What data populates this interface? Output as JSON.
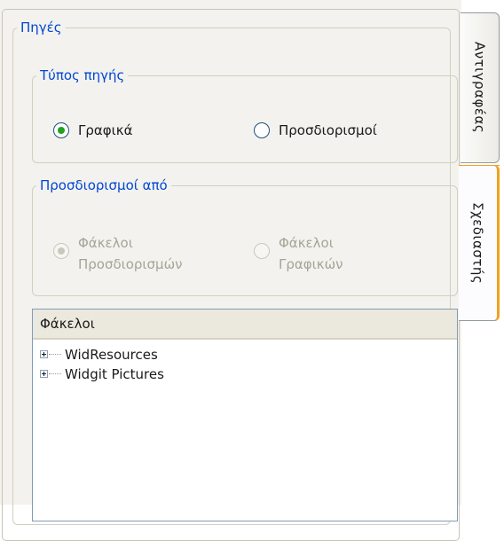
{
  "sources": {
    "title": "Πηγές",
    "source_type": {
      "title": "Τύπος πηγής",
      "options": [
        {
          "label": "Γραφικά",
          "checked": true
        },
        {
          "label": "Προσδιορισμοί",
          "checked": false
        }
      ]
    },
    "determiners_from": {
      "title": "Προσδιορισμοί από",
      "disabled": true,
      "options": [
        {
          "label": "Φάκελοι\nΠροσδιορισμών",
          "checked": true
        },
        {
          "label": "Φάκελοι\nΓραφικών",
          "checked": false
        }
      ]
    },
    "folders": {
      "header": "Φάκελοι",
      "items": [
        "WidResources",
        "Widgit Pictures"
      ]
    }
  },
  "tabs": {
    "copy": "Αντιγραφέας",
    "design": "Σχεδιαστής"
  },
  "colors": {
    "legend_blue": "#0046d5",
    "radio_green": "#21a121",
    "tab_accent": "#f0a21d"
  },
  "icons": {
    "tree_expand": "plus-box-icon"
  }
}
